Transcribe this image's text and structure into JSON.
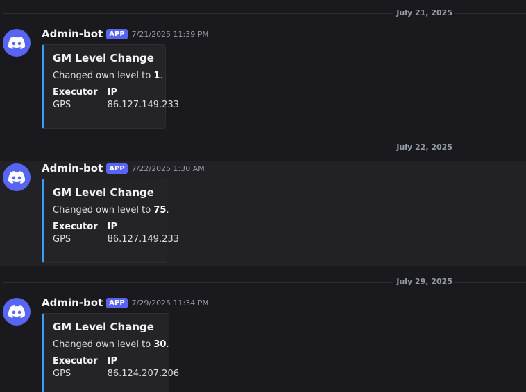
{
  "messages": [
    {
      "date_divider": "July 21, 2025",
      "author": "Admin-bot",
      "badge": "APP",
      "timestamp": "7/21/2025 11:39 PM",
      "embed": {
        "title": "GM Level Change",
        "description_prefix": "Changed own level to ",
        "level": "1",
        "description_suffix": ".",
        "fields": [
          {
            "name": "Executor",
            "value": "GPS"
          },
          {
            "name": "IP",
            "value": "86.127.149.233"
          }
        ]
      }
    },
    {
      "date_divider": "July 22, 2025",
      "author": "Admin-bot",
      "badge": "APP",
      "timestamp": "7/22/2025 1:30 AM",
      "embed": {
        "title": "GM Level Change",
        "description_prefix": "Changed own level to ",
        "level": "75",
        "description_suffix": ".",
        "fields": [
          {
            "name": "Executor",
            "value": "GPS"
          },
          {
            "name": "IP",
            "value": "86.127.149.233"
          }
        ]
      }
    },
    {
      "date_divider": "July 29, 2025",
      "author": "Admin-bot",
      "badge": "APP",
      "timestamp": "7/29/2025 11:34 PM",
      "embed": {
        "title": "GM Level Change",
        "description_prefix": "Changed own level to ",
        "level": "30",
        "description_suffix": ".",
        "fields": [
          {
            "name": "Executor",
            "value": "GPS"
          },
          {
            "name": "IP",
            "value": "86.124.207.206"
          }
        ]
      }
    }
  ],
  "colors": {
    "background": "#1a1a1e",
    "hover_row": "#222226",
    "embed_accent": "#3a9ff0",
    "blurple": "#5865f2"
  },
  "icons": {
    "avatar": "discord-logo-icon"
  }
}
